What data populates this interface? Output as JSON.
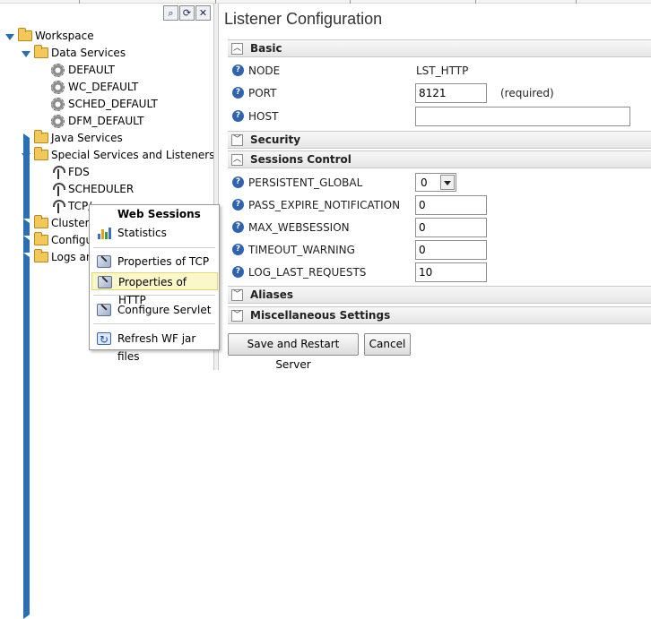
{
  "toolbar": {
    "buttons": [
      {
        "name": "binoculars-icon",
        "glyph": "⌕"
      },
      {
        "name": "refresh-icon",
        "glyph": "⟳"
      },
      {
        "name": "close-icon",
        "glyph": "✕"
      }
    ]
  },
  "tree": {
    "root": "Workspace",
    "data_services": {
      "label": "Data Services",
      "children": [
        "DEFAULT",
        "WC_DEFAULT",
        "SCHED_DEFAULT",
        "DFM_DEFAULT"
      ]
    },
    "java_services": "Java Services",
    "special": {
      "label": "Special Services and Listeners",
      "children": [
        "FDS",
        "SCHEDULER",
        "TCP/"
      ]
    },
    "cluster": "Cluster M",
    "configure": "Configu",
    "logs": "Logs and"
  },
  "context_menu": {
    "header": "Web Sessions",
    "items": [
      "Statistics",
      "Properties of TCP",
      "Properties of HTTP",
      "Configure Servlet",
      "Refresh WF jar files"
    ],
    "highlighted": "Properties of HTTP"
  },
  "main": {
    "title": "Listener Configuration",
    "sections": {
      "basic": "Basic",
      "security": "Security",
      "sessions": "Sessions Control",
      "aliases": "Aliases",
      "misc": "Miscellaneous Settings"
    },
    "basic_fields": {
      "node_label": "NODE",
      "node_value": "LST_HTTP",
      "port_label": "PORT",
      "port_value": "8121",
      "port_required": "(required)",
      "host_label": "HOST",
      "host_value": ""
    },
    "session_fields": {
      "persistent_label": "PERSISTENT_GLOBAL",
      "persistent_value": "0",
      "pass_expire_label": "PASS_EXPIRE_NOTIFICATION",
      "pass_expire_value": "0",
      "max_web_label": "MAX_WEBSESSION",
      "max_web_value": "0",
      "timeout_label": "TIMEOUT_WARNING",
      "timeout_value": "0",
      "log_last_label": "LOG_LAST_REQUESTS",
      "log_last_value": "10"
    },
    "buttons": {
      "save": "Save and Restart Server",
      "cancel": "Cancel"
    }
  },
  "colors": {
    "accent_blue": "#2f63b0",
    "highlight_bg": "#fbf7c8",
    "folder": "#f3c85b"
  }
}
